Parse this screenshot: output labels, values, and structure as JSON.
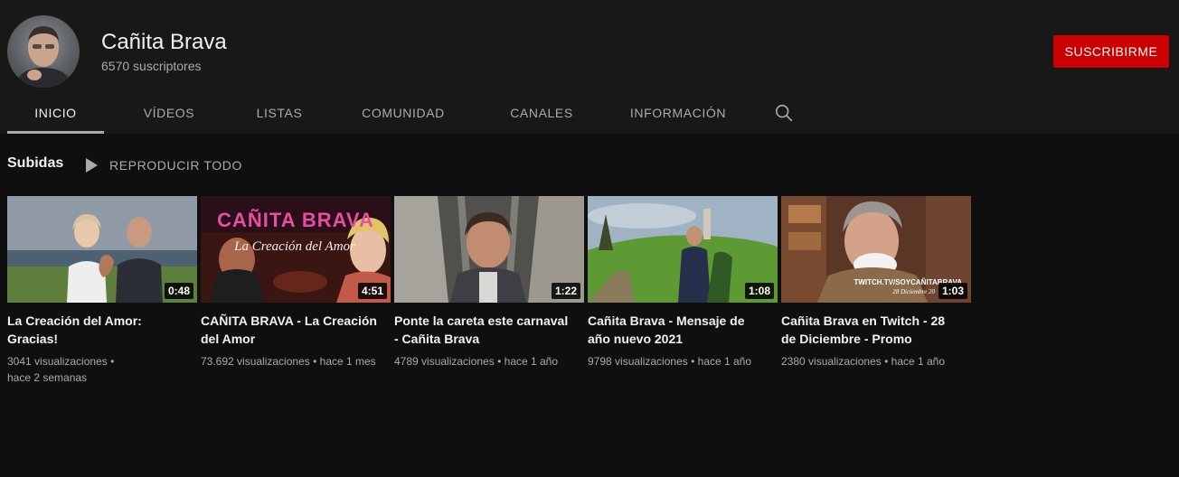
{
  "channel": {
    "name": "Cañita Brava",
    "subscribers": "6570 suscriptores",
    "subscribe_label": "SUSCRIBIRME"
  },
  "tabs": [
    {
      "label": "INICIO",
      "active": true
    },
    {
      "label": "VÍDEOS"
    },
    {
      "label": "LISTAS"
    },
    {
      "label": "COMUNIDAD"
    },
    {
      "label": "CANALES"
    },
    {
      "label": "INFORMACIÓN"
    }
  ],
  "section": {
    "title": "Subidas",
    "play_all": "REPRODUCIR TODO"
  },
  "videos": [
    {
      "title": "La Creación del Amor: Gracias!",
      "duration": "0:48",
      "views": "3041 visualizaciones",
      "age": "hace 2 semanas"
    },
    {
      "title": "CAÑITA BRAVA - La Creación del Amor",
      "duration": "4:51",
      "views": "73.692 visualizaciones",
      "age": "hace 1 mes",
      "overlay_title": "CAÑITA BRAVA",
      "overlay_subtitle": "La Creación del Amor"
    },
    {
      "title": "Ponte la careta este carnaval - Cañita Brava",
      "duration": "1:22",
      "views": "4789 visualizaciones",
      "age": "hace 1 año"
    },
    {
      "title": "Cañita Brava - Mensaje de año nuevo 2021",
      "duration": "1:08",
      "views": "9798 visualizaciones",
      "age": "hace 1 año"
    },
    {
      "title": "Cañita Brava en Twitch - 28 de Diciembre - Promo",
      "duration": "1:03",
      "views": "2380 visualizaciones",
      "age": "hace 1 año",
      "overlay_line1": "TWITCH.TV/SOYCAÑITABRAVA",
      "overlay_line2": "28 Diciembre 20"
    }
  ],
  "meta_separator": "•",
  "colors": {
    "page_bg": "#0f0f0f",
    "header_bg": "#181818",
    "subscribe": "#cc0000",
    "secondary_text": "#aaaaaa"
  },
  "icons": {
    "search": "search-icon",
    "play": "play-icon"
  }
}
